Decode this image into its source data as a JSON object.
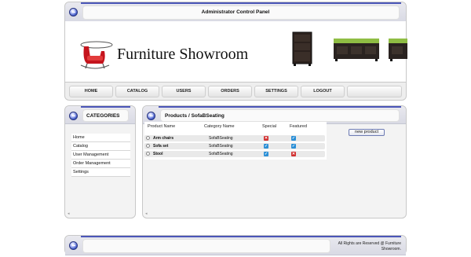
{
  "header": {
    "title": "Administrator Control Panel",
    "brand": "Furniture Showroom"
  },
  "nav": {
    "items": [
      {
        "label": "HOME"
      },
      {
        "label": "CATALOG"
      },
      {
        "label": "USERS"
      },
      {
        "label": "ORDERS"
      },
      {
        "label": "SETTINGS"
      },
      {
        "label": "LOGOUT"
      },
      {
        "label": ""
      }
    ]
  },
  "sidebar": {
    "title": "CATEGORIES",
    "items": [
      {
        "label": "Home"
      },
      {
        "label": "Catalog"
      },
      {
        "label": "User Management"
      },
      {
        "label": "Order Management"
      },
      {
        "label": "Settings"
      }
    ]
  },
  "products": {
    "title": "Products / SofaBSeating",
    "columns": {
      "name": "Product Name",
      "category": "Category Name",
      "special": "Special",
      "featured": "Featured"
    },
    "rows": [
      {
        "name": "Arm chairs",
        "category": "SofaBSeating",
        "special": false,
        "featured": true
      },
      {
        "name": "Sofa set",
        "category": "SofaBSeating",
        "special": true,
        "featured": true
      },
      {
        "name": "Stool",
        "category": "SofaBSeating",
        "special": true,
        "featured": false
      }
    ],
    "new_button": "new product"
  },
  "footer": {
    "line1": "All Rights are Reserved @ Furniture",
    "line2": "Showroom."
  },
  "colors": {
    "accent": "#4b56b8",
    "check_yes": "#2b8fd6",
    "check_no": "#d12f2f"
  }
}
